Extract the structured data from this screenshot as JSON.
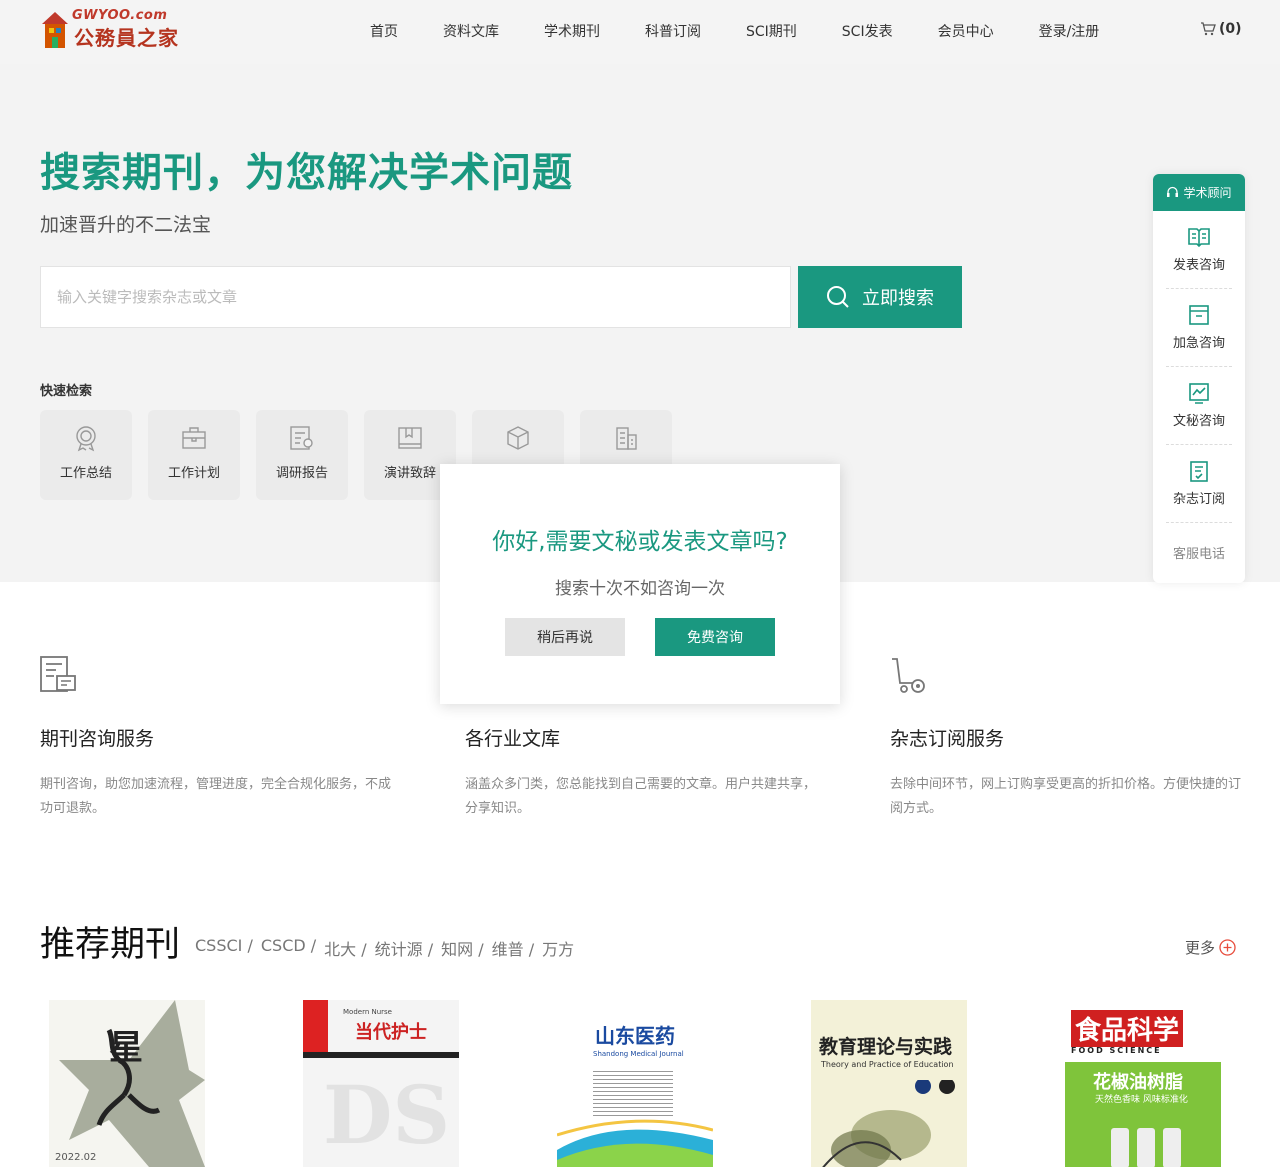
{
  "header": {
    "logo_domain": "GWYOO.com",
    "logo_name": "公務員之家",
    "nav": [
      "首页",
      "资料文库",
      "学术期刊",
      "科普订阅",
      "SCI期刊",
      "SCI发表",
      "会员中心",
      "登录/注册"
    ],
    "cart_count": "(0)"
  },
  "hero": {
    "title": "搜索期刊，为您解决学术问题",
    "subtitle": "加速晋升的不二法宝",
    "search_placeholder": "输入关键字搜索杂志或文章",
    "search_button": "立即搜索",
    "quick_title": "快速检索",
    "quick_items": [
      "工作总结",
      "工作计划",
      "调研报告",
      "演讲致辞",
      "",
      ""
    ]
  },
  "side": {
    "head": "学术顾问",
    "items": [
      "发表咨询",
      "加急咨询",
      "文秘咨询",
      "杂志订阅"
    ],
    "phone": "客服电话"
  },
  "services": [
    {
      "title": "期刊咨询服务",
      "desc": "期刊咨询，助您加速流程，管理进度，完全合规化服务，不成功可退款。"
    },
    {
      "title": "各行业文库",
      "desc": "涵盖众多门类，您总能找到自己需要的文章。用户共建共享，分享知识。"
    },
    {
      "title": "杂志订阅服务",
      "desc": "去除中间环节，网上订购享受更高的折扣价格。方便快捷的订阅方式。"
    }
  ],
  "modal": {
    "title": "你好,需要文秘或发表文章吗?",
    "subtitle": "搜索十次不如咨询一次",
    "later": "稍后再说",
    "free": "免费咨询"
  },
  "recommend": {
    "title": "推荐期刊",
    "tags": [
      "CSSCI /",
      "CSCD /",
      "北大 /",
      "统计源 /",
      "知网 /",
      "维普 /",
      "万方"
    ],
    "more": "更多"
  },
  "covers": [
    {
      "title": "星",
      "date": "2022.02"
    },
    {
      "title": "当代护士",
      "sub": "Modern Nurse"
    },
    {
      "title": "山东医药",
      "sub": "Shandong Medical Journal"
    },
    {
      "title": "教育理论与实践",
      "sub": "Theory and Practice of Education"
    },
    {
      "title": "食品科学",
      "sub": "FOOD SCIENCE",
      "headline": "花椒油树脂",
      "tagline": "天然色香味 风味标准化"
    }
  ],
  "colors": {
    "accent": "#1a9880",
    "hero_bg": "#f3f3f3",
    "header_bg": "#f4f4f4"
  }
}
